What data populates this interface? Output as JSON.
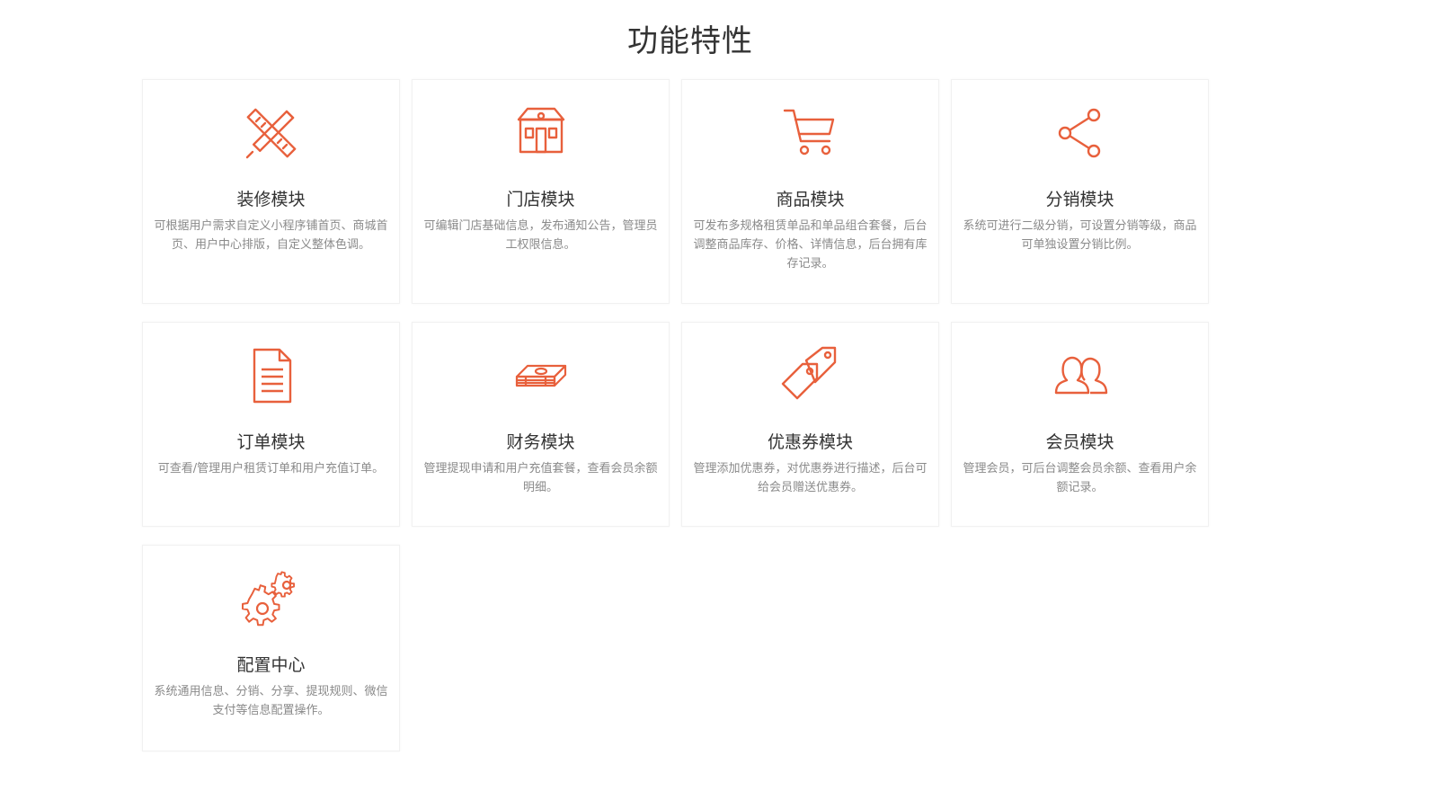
{
  "page": {
    "title": "功能特性"
  },
  "colors": {
    "accent": "#e8603c",
    "title": "#333333",
    "desc": "#8a8a8a",
    "card_border": "#f1f1f1"
  },
  "features": [
    {
      "icon": "pencil-ruler-icon",
      "title": "装修模块",
      "desc": "可根据用户需求自定义小程序铺首页、商城首页、用户中心排版，自定义整体色调。"
    },
    {
      "icon": "store-icon",
      "title": "门店模块",
      "desc": "可编辑门店基础信息，发布通知公告，管理员工权限信息。"
    },
    {
      "icon": "shopping-cart-icon",
      "title": "商品模块",
      "desc": "可发布多规格租赁单品和单品组合套餐，后台调整商品库存、价格、详情信息，后台拥有库存记录。"
    },
    {
      "icon": "share-icon",
      "title": "分销模块",
      "desc": "系统可进行二级分销，可设置分销等级，商品可单独设置分销比例。"
    },
    {
      "icon": "document-icon",
      "title": "订单模块",
      "desc": "可查看/管理用户租赁订单和用户充值订单。"
    },
    {
      "icon": "money-stack-icon",
      "title": "财务模块",
      "desc": "管理提现申请和用户充值套餐，查看会员余额明细。"
    },
    {
      "icon": "coupon-tags-icon",
      "title": "优惠券模块",
      "desc": "管理添加优惠券，对优惠券进行描述，后台可给会员赠送优惠券。"
    },
    {
      "icon": "members-icon",
      "title": "会员模块",
      "desc": "管理会员，可后台调整会员余额、查看用户余额记录。"
    },
    {
      "icon": "gears-icon",
      "title": "配置中心",
      "desc": "系统通用信息、分销、分享、提现规则、微信支付等信息配置操作。"
    }
  ]
}
